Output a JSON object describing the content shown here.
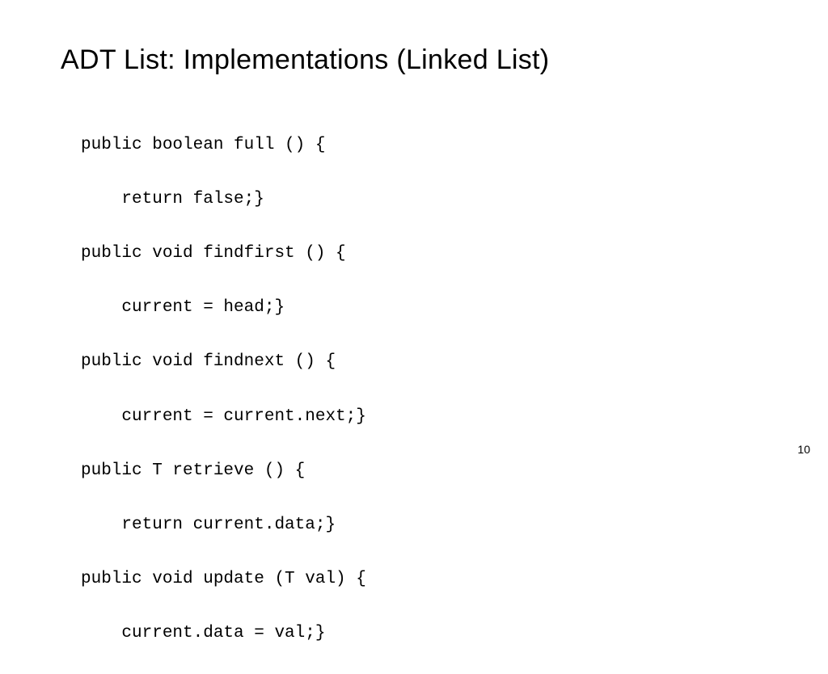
{
  "slide": {
    "title": "ADT List: Implementations (Linked List)",
    "page_number": "10",
    "code_lines": [
      "public boolean full () {",
      "    return false;}",
      "public void findfirst () {",
      "    current = head;}",
      "public void findnext () {",
      "    current = current.next;}",
      "public T retrieve () {",
      "    return current.data;}",
      "public void update (T val) {",
      "    current.data = val;}"
    ]
  }
}
